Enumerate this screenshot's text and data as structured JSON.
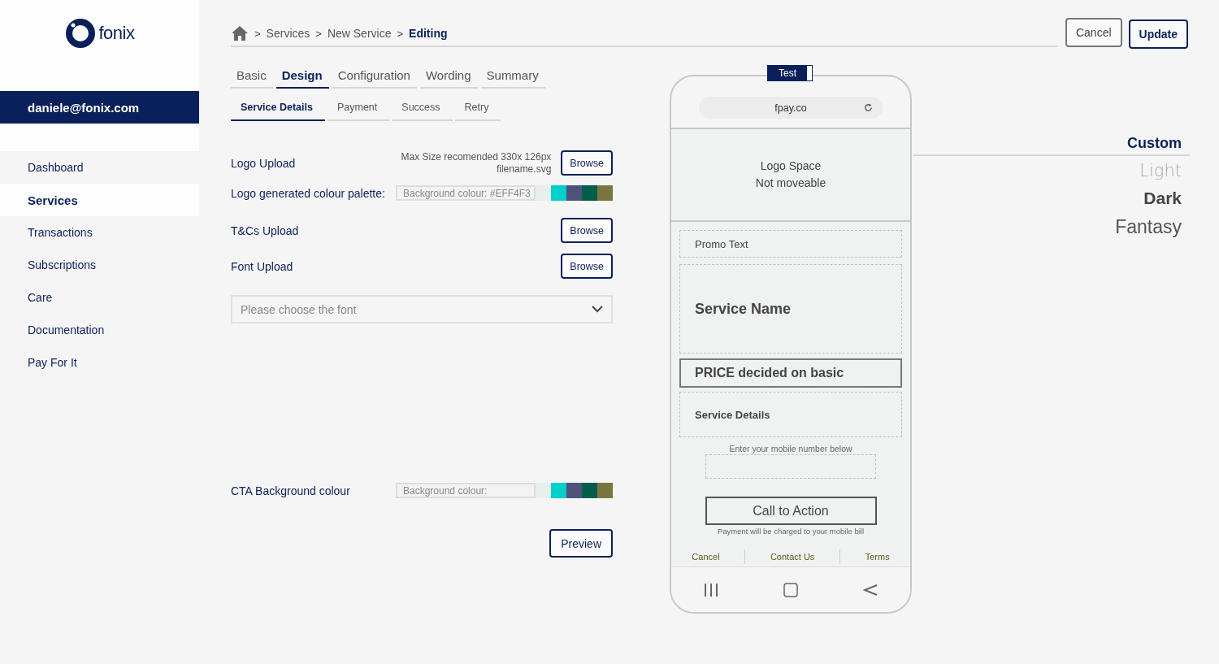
{
  "logo": {
    "text": "fonix"
  },
  "user": {
    "email": "daniele@fonix.com"
  },
  "sidebar": {
    "items": [
      {
        "label": "Dashboard",
        "selected": false
      },
      {
        "label": "Services",
        "selected": true
      },
      {
        "label": "Transactions",
        "selected": false
      },
      {
        "label": "Subscriptions",
        "selected": false
      },
      {
        "label": "Care",
        "selected": false
      },
      {
        "label": "Documentation",
        "selected": false
      },
      {
        "label": "Pay For It",
        "selected": false
      }
    ]
  },
  "breadcrumb": [
    {
      "label": "Services",
      "current": false
    },
    {
      "label": "New Service",
      "current": false
    },
    {
      "label": "Editing",
      "current": true
    }
  ],
  "breadcrumb_separator": ">",
  "header_buttons": [
    {
      "label": "Cancel",
      "kind": "secondary"
    },
    {
      "label": "Update",
      "kind": "primary"
    }
  ],
  "tabs": [
    {
      "label": "Basic",
      "selected": false
    },
    {
      "label": "Design",
      "selected": true
    },
    {
      "label": "Configuration",
      "selected": false
    },
    {
      "label": "Wording",
      "selected": false
    },
    {
      "label": "Summary",
      "selected": false
    }
  ],
  "subtabs": [
    {
      "label": "Service Details",
      "selected": true
    },
    {
      "label": "Payment",
      "selected": false
    },
    {
      "label": "Success",
      "selected": false
    },
    {
      "label": "Retry",
      "selected": false
    }
  ],
  "logo_upload": {
    "label": "Logo Upload",
    "hint": "Max Size recomended 330x 126px",
    "filename": "filename.svg",
    "button": "Browse"
  },
  "logo_palette": {
    "label": "Logo generated colour palette:",
    "value": "Background colour: #EFF4F3",
    "swatches": [
      {
        "color": "#e6efed"
      },
      {
        "color": "#00cfcb"
      },
      {
        "color": "#4f527a"
      },
      {
        "color": "#005e4a"
      },
      {
        "color": "#7a7642"
      }
    ]
  },
  "tcs_upload": {
    "label": "T&Cs Upload",
    "button": "Browse"
  },
  "font_upload": {
    "label": "Font Upload",
    "button": "Browse"
  },
  "font_select": {
    "placeholder": "Please choose the font"
  },
  "cta_palette": {
    "label": "CTA Background colour",
    "value": "Background colour:",
    "swatches": [
      {
        "color": "#e6efed"
      },
      {
        "color": "#00cfcb"
      },
      {
        "color": "#4f527a"
      },
      {
        "color": "#005e4a"
      },
      {
        "color": "#7a7642"
      }
    ]
  },
  "preview_button": "Preview",
  "phone": {
    "test_toggle": {
      "label": "Test",
      "on": true
    },
    "url": "fpay.co",
    "logo_space": [
      "Logo Space",
      "Not moveable"
    ],
    "promo_text": "Promo Text",
    "service_name": "Service Name",
    "price": "PRICE decided on basic",
    "service_details": "Service Details",
    "mobile_label": "Enter your mobile number below",
    "cta": "Call to Action",
    "charge_note": "Payment will be charged to your mobile bill",
    "footer_links": [
      "Cancel",
      "Contact Us",
      "Terms"
    ]
  },
  "themes": [
    {
      "label": "Custom",
      "kind": "custom",
      "selected": true
    },
    {
      "label": "Light",
      "kind": "light",
      "selected": false
    },
    {
      "label": "Dark",
      "kind": "dark",
      "selected": false
    },
    {
      "label": "Fantasy",
      "kind": "fantasy",
      "selected": false
    }
  ]
}
